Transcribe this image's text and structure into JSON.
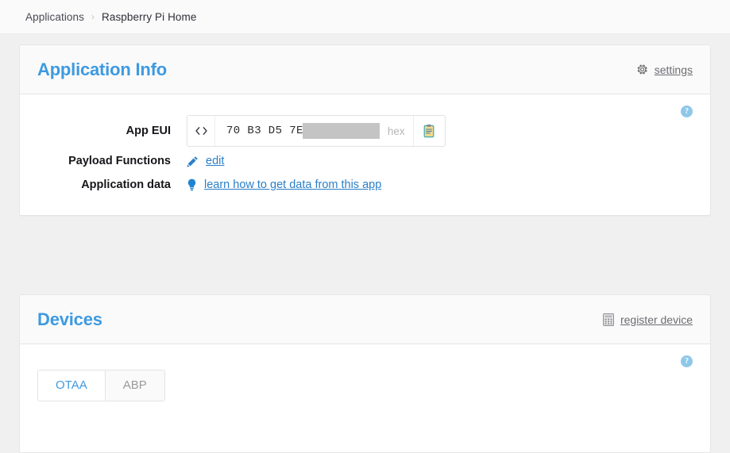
{
  "breadcrumb": {
    "root_label": "Applications",
    "separator": "›",
    "current_label": "Raspberry Pi Home"
  },
  "application_info": {
    "title": "Application Info",
    "settings_label": "settings",
    "settings_icon": "gear-icon",
    "help_icon": "question-mark-icon",
    "help_glyph": "?",
    "rows": {
      "app_eui": {
        "label": "App EUI",
        "code_icon": "code-brackets-icon",
        "value": "70 B3 D5 7E",
        "redacted": true,
        "unit": "hex",
        "copy_icon": "clipboard-icon"
      },
      "payload_functions": {
        "label": "Payload Functions",
        "icon": "pencil-icon",
        "link_label": "edit"
      },
      "application_data": {
        "label": "Application data",
        "icon": "lightbulb-icon",
        "link_label": "learn how to get data from this app"
      }
    }
  },
  "devices": {
    "title": "Devices",
    "register_label": "register device",
    "register_icon": "calculator-icon",
    "help_icon": "question-mark-icon",
    "help_glyph": "?",
    "tabs": [
      {
        "label": "OTAA",
        "active": true
      },
      {
        "label": "ABP",
        "active": false
      }
    ]
  },
  "colors": {
    "accent_blue": "#3d9ae0",
    "link_blue": "#2a7fc9",
    "page_background": "#f0f0f0",
    "panel_background": "#ffffff",
    "panel_header_background": "#fafafa",
    "redaction_gray": "#c4c4c4",
    "help_icon_blue": "#8fc7e8"
  }
}
